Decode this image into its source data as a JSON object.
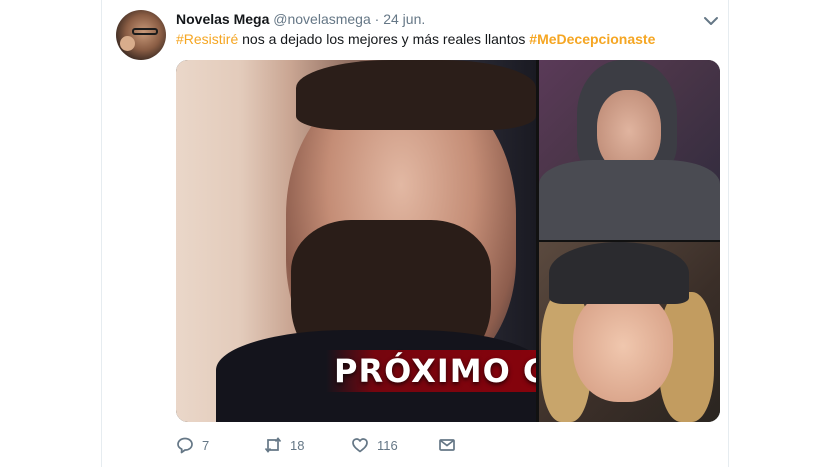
{
  "tweet": {
    "author_name": "Novelas Mega",
    "author_handle": "@novelasmega",
    "separator": "·",
    "date": "24 jun.",
    "text_parts": [
      {
        "type": "hashtag",
        "text": "#Resistiré"
      },
      {
        "type": "text",
        "text": " nos a dejado los mejores y más reales llantos "
      },
      {
        "type": "hashtag",
        "text": "#MeDecepcionaste"
      }
    ],
    "media_caption": "PRÓXIMO CAPÍT",
    "actions": {
      "reply_count": "7",
      "retweet_count": "18",
      "like_count": "116"
    },
    "icons": {
      "menu": "chevron-down-icon",
      "reply": "reply-icon",
      "retweet": "retweet-icon",
      "like": "heart-icon",
      "dm": "envelope-icon"
    },
    "colors": {
      "hashtag": "#f5a623",
      "muted": "#657786",
      "text": "#14171a"
    }
  }
}
